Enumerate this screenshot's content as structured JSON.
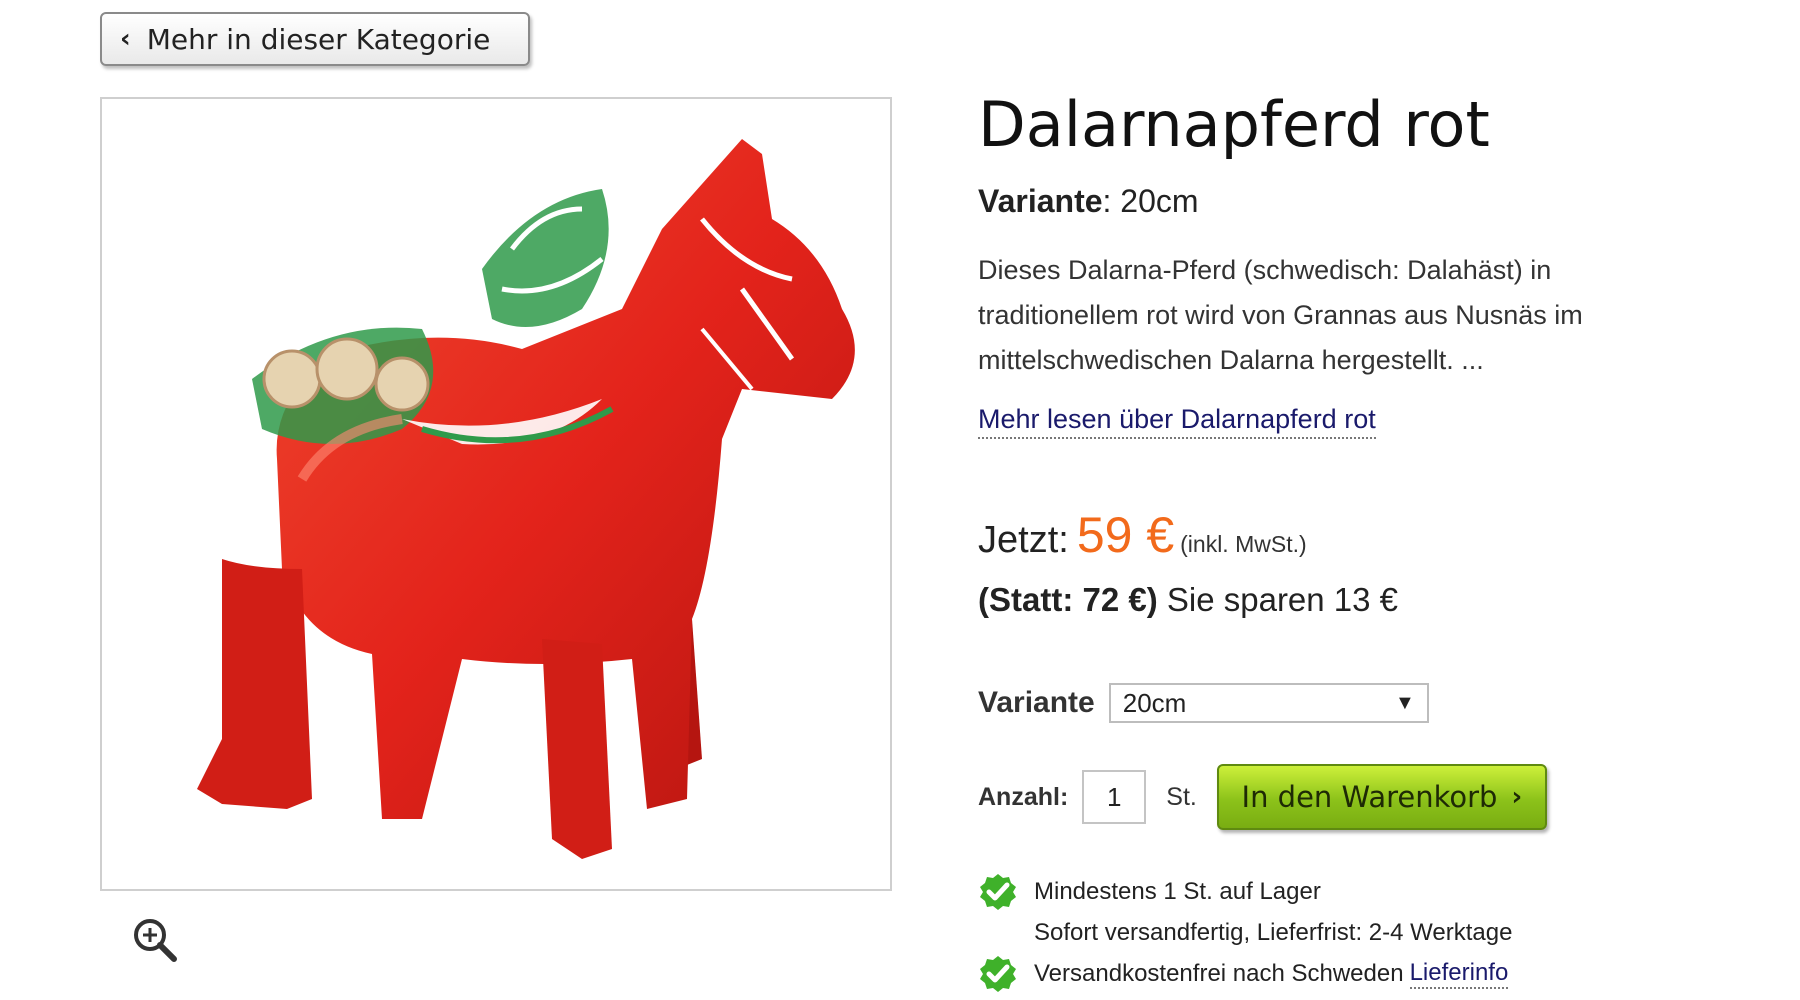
{
  "nav": {
    "back_label": "Mehr in dieser Kategorie"
  },
  "product": {
    "title": "Dalarnapferd rot",
    "variant_label": "Variante",
    "variant_value": ": 20cm",
    "description": "Dieses Dalarna-Pferd (schwedisch: Dalahäst) in traditionellem rot wird von Grannas aus Nusnäs im mittelschwedischen Dalarna hergestellt. ...",
    "read_more": "Mehr lesen über Dalarnapferd rot"
  },
  "pricing": {
    "now_label": "Jetzt:",
    "price": "59 €",
    "tax_note": "(inkl. MwSt.)",
    "old_price": "(Statt: 72 €)",
    "savings": "Sie sparen 13 €"
  },
  "purchase": {
    "variant_label": "Variante",
    "variant_selected": "20cm",
    "qty_label": "Anzahl:",
    "qty_value": "1",
    "qty_unit": "St.",
    "cart_label": "In den Warenkorb"
  },
  "stock": {
    "line1": "Mindestens 1 St. auf Lager",
    "line2": "Sofort versandfertig, Lieferfrist: 2-4 Werktage",
    "line3": "Versandkostenfrei nach Schweden",
    "delivery_link": "Lieferinfo"
  },
  "colors": {
    "price": "#f26a1b",
    "cart_button": "#8cc21a",
    "check": "#3fb12a",
    "horse": "#e8281e"
  },
  "icons": {
    "back": "chevron-left-icon",
    "zoom": "zoom-in-icon",
    "check": "check-badge-icon",
    "cart": "chevron-right-icon"
  }
}
